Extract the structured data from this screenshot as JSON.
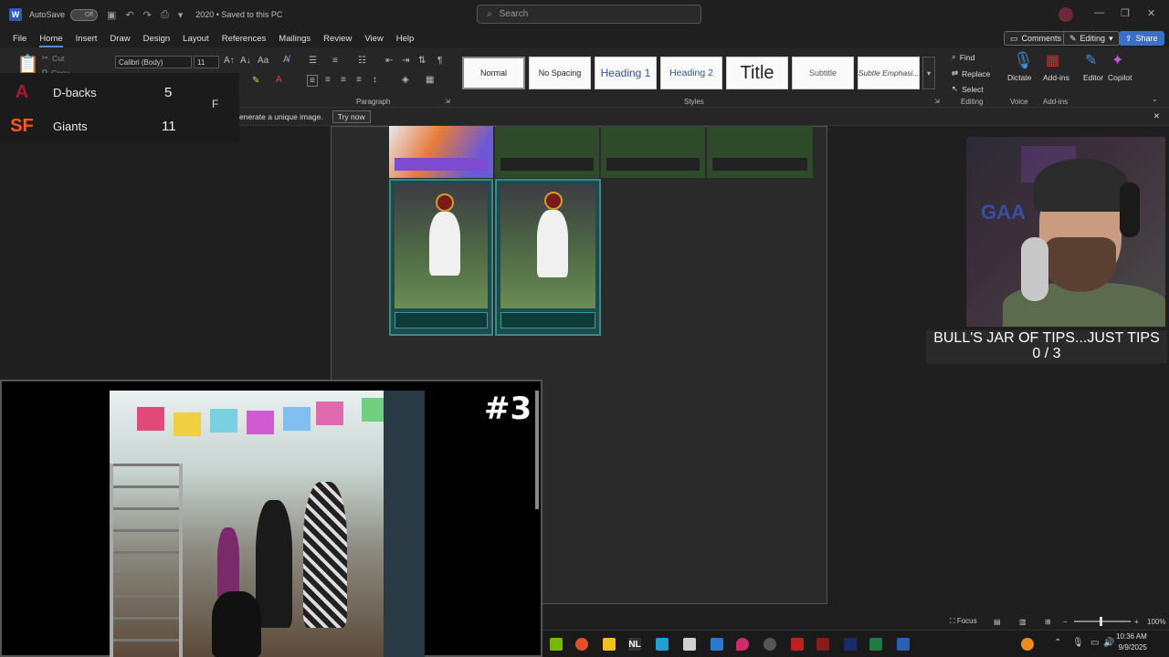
{
  "titlebar": {
    "app_letter": "W",
    "autosave_label": "AutoSave",
    "autosave_state": "Off",
    "document_name": "2020 • Saved to this PC",
    "search_placeholder": "Search"
  },
  "menu": {
    "tabs": [
      "File",
      "Home",
      "Insert",
      "Draw",
      "Design",
      "Layout",
      "References",
      "Mailings",
      "Review",
      "View",
      "Help"
    ],
    "active_tab": "Home",
    "comments_label": "Comments",
    "editing_label": "Editing",
    "share_label": "Share"
  },
  "ribbon": {
    "clipboard": {
      "cut": "Cut",
      "copy": "Copy"
    },
    "font": {
      "family": "Calibri (Body)",
      "size": "11"
    },
    "paragraph_label": "Paragraph",
    "styles_label": "Styles",
    "styles": [
      "Normal",
      "No Spacing",
      "Heading 1",
      "Heading 2",
      "Title",
      "Subtitle",
      "Subtle Emphasi..."
    ],
    "editing": {
      "find": "Find",
      "replace": "Replace",
      "select": "Select",
      "group_label": "Editing"
    },
    "voice": {
      "dictate": "Dictate",
      "group_label": "Voice"
    },
    "addins": {
      "addins": "Add-ins",
      "group_label": "Add-ins"
    },
    "editor": "Editor",
    "copilot": "Copilot"
  },
  "infobar": {
    "message": "enerate a unique image.",
    "action": "Try now"
  },
  "scoreboard": {
    "teams": [
      {
        "name": "D-backs",
        "score": "5"
      },
      {
        "name": "Giants",
        "score": "11"
      }
    ],
    "status": "F"
  },
  "overlay": {
    "tips_title": "BULL'S JAR OF TIPS...JUST TIPS",
    "tips_count": "0 / 3",
    "rank_label": "#3"
  },
  "statusbar": {
    "focus": "Focus",
    "zoom": "100%"
  },
  "taskbar": {
    "time": "10:36 AM",
    "date": "9/9/2025",
    "nl_label": "NL"
  },
  "colors": {
    "accent": "#4a8fdc",
    "share": "#3b6fc6",
    "dbacks": "#a71930",
    "giants": "#fd5a1e"
  }
}
